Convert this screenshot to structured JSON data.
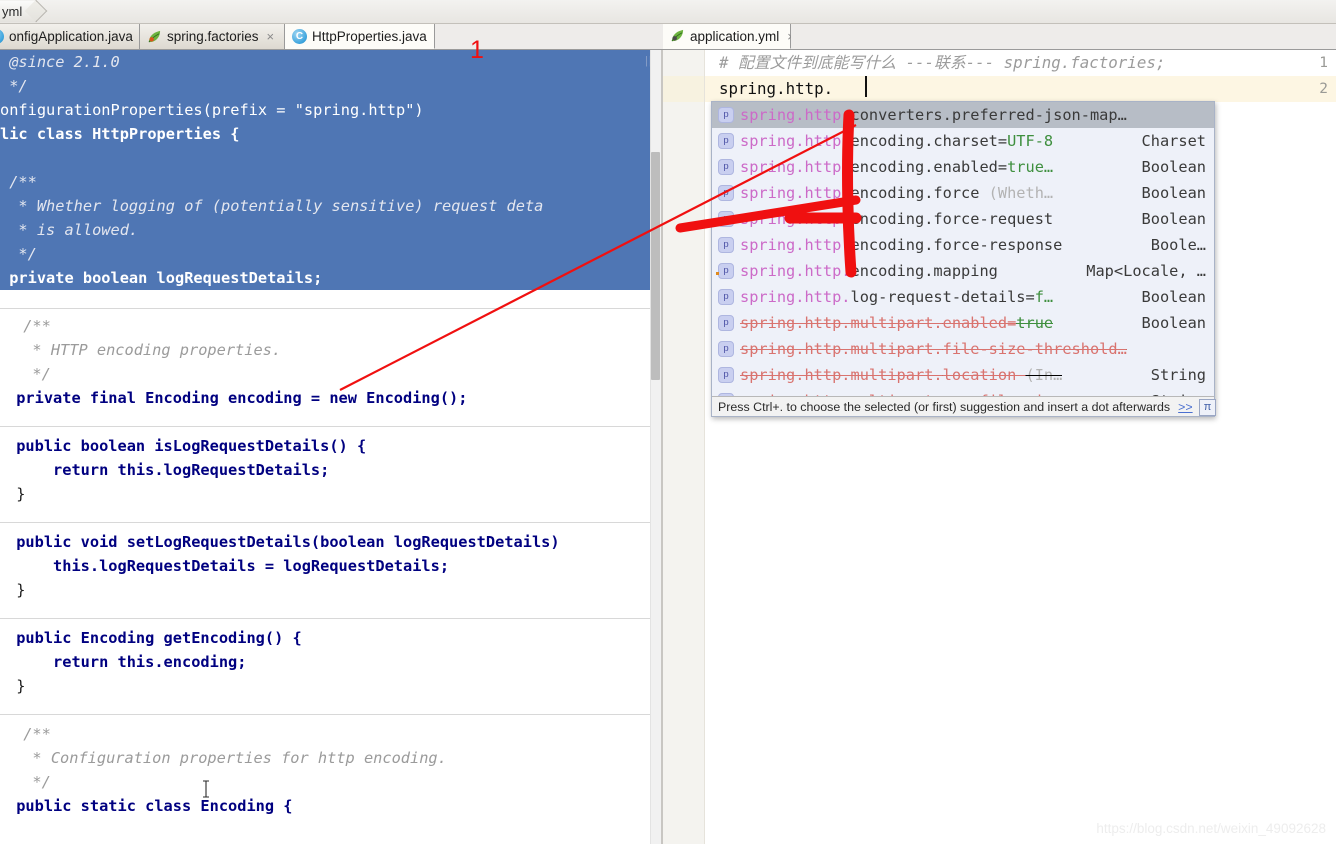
{
  "breadcrumb": {
    "text": "yml"
  },
  "tabs": [
    {
      "label": "onfigApplication.java",
      "icon": "java-class-icon",
      "close": "×",
      "active": false
    },
    {
      "label": "spring.factories",
      "icon": "spring-leaf-icon",
      "close": "×",
      "active": false
    },
    {
      "label": "HttpProperties.java",
      "icon": "java-class-icon",
      "close": "×",
      "active": true
    },
    {
      "label": "application.yml",
      "icon": "spring-leaf-icon",
      "close": "×",
      "active": true
    }
  ],
  "annotation": {
    "number": "1",
    "color": "#f01010"
  },
  "left_editor": {
    "selection_color": "#4f76b4",
    "selected_lines": [
      " @since 2.1.0",
      " */",
      "onfigurationProperties(prefix = \"spring.http\")",
      "lic class HttpProperties {",
      "",
      " /**",
      "  * Whether logging of (potentially sensitive) request deta",
      "  * is allowed.",
      "  */",
      " private boolean logRequestDetails;"
    ],
    "blocks": [
      {
        "lines": [
          " /**",
          "  * HTTP encoding properties.",
          "  */",
          " private final Encoding encoding = new Encoding();"
        ]
      },
      {
        "lines": [
          " public boolean isLogRequestDetails() {",
          "     return this.logRequestDetails;",
          " }"
        ]
      },
      {
        "lines": [
          " public void setLogRequestDetails(boolean logRequestDetails)",
          "     this.logRequestDetails = logRequestDetails;",
          " }"
        ]
      },
      {
        "lines": [
          " public Encoding getEncoding() {",
          "     return this.encoding;",
          " }"
        ]
      },
      {
        "lines": [
          " /**",
          "  * Configuration properties for http encoding.",
          "  */",
          " public static class Encoding {"
        ]
      }
    ]
  },
  "right_editor": {
    "line_numbers": [
      "1",
      "2"
    ],
    "lines": [
      "# 配置文件到底能写什么 ---联系--- spring.factories;",
      "spring.http."
    ]
  },
  "completion_popup": {
    "icon_label": "p",
    "items": [
      {
        "prefix": "spring.http.",
        "rest": "converters.preferred-json-map…",
        "type": "",
        "selected": true,
        "deprecated": false
      },
      {
        "prefix": "spring.http.",
        "rest": "encoding.charset=",
        "value": "UTF-8",
        "type": "Charset",
        "selected": false,
        "deprecated": false
      },
      {
        "prefix": "spring.http.",
        "rest": "encoding.enabled=",
        "value": "true…",
        "type": "Boolean",
        "selected": false,
        "deprecated": false
      },
      {
        "prefix": "spring.http.",
        "rest": "encoding.force ",
        "hint": "(Wheth…",
        "type": "Boolean",
        "selected": false,
        "deprecated": false
      },
      {
        "prefix": "spring.http.",
        "rest": "encoding.force-request",
        "type": "Boolean",
        "selected": false,
        "deprecated": false
      },
      {
        "prefix": "spring.http.",
        "rest": "encoding.force-response",
        "type": "Boole…",
        "selected": false,
        "deprecated": false
      },
      {
        "prefix": "spring.http.",
        "rest": "encoding.mapping",
        "type": "Map<Locale, …",
        "selected": false,
        "deprecated": false,
        "dot": true
      },
      {
        "prefix": "spring.http.",
        "rest": "log-request-details=",
        "value": "f…",
        "type": "Boolean",
        "selected": false,
        "deprecated": false
      },
      {
        "prefix": "spring.http.multipart.",
        "rest": "enabled=",
        "value": "true",
        "type": "Boolean",
        "selected": false,
        "deprecated": true
      },
      {
        "prefix": "spring.http.multipart.",
        "rest": "file-size-threshold…",
        "type": "",
        "selected": false,
        "deprecated": true
      },
      {
        "prefix": "spring.http.multipart.",
        "rest": "location ",
        "hint": "(In…",
        "type": "String",
        "selected": false,
        "deprecated": true
      },
      {
        "prefix": "spring.http.multipart.",
        "rest": "max-file-size",
        "type": "String",
        "selected": false,
        "deprecated": true
      }
    ],
    "footer": "Press Ctrl+. to choose the selected (or first) suggestion and insert a dot afterwards",
    "footer_more": ">>",
    "badge": "π"
  },
  "watermark": {
    "text": "https://blog.csdn.net/weixin_49092628"
  }
}
